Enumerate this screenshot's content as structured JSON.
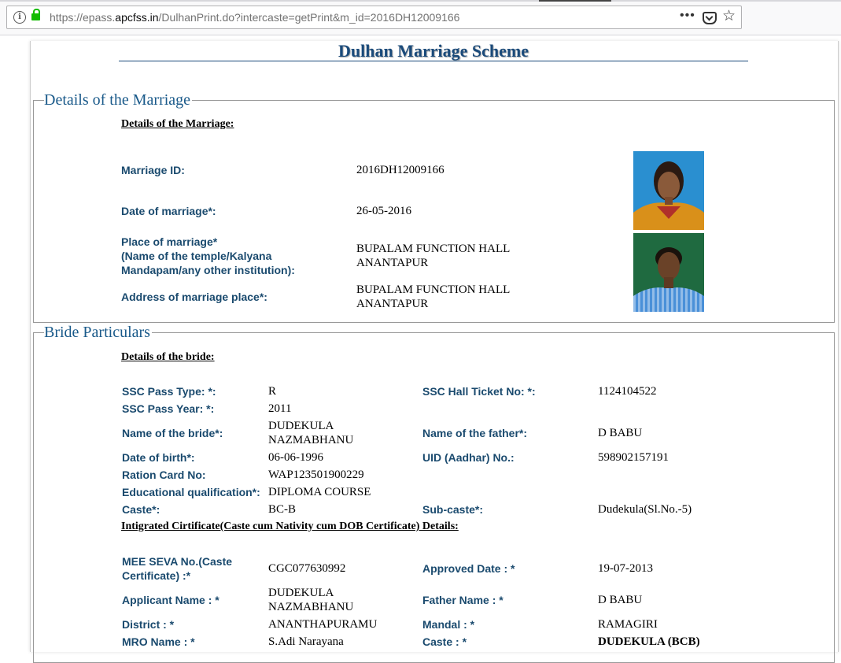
{
  "browser": {
    "url_prefix": "https://epass.",
    "url_domain": "apcfss.in",
    "url_suffix": "/DulhanPrint.do?intercaste=getPrint&m_id=2016DH12009166",
    "menu_glyph": "•••",
    "bookmark_glyph": "☆",
    "info_glyph": "i"
  },
  "page_title": "Dulhan Marriage Scheme",
  "marriage": {
    "legend": "Details of the Marriage",
    "heading": "Details of the Marriage:",
    "id_label": "Marriage ID:",
    "id_value": "2016DH12009166",
    "date_label": "Date of marriage*:",
    "date_value": "26-05-2016",
    "place_label_1": "Place of marriage*",
    "place_label_2": "(Name of the temple/Kalyana",
    "place_label_3": "Mandapam/any other institution):",
    "place_value_1": "BUPALAM FUNCTION HALL",
    "place_value_2": "ANANTAPUR",
    "address_label": "Address of marriage place*:",
    "address_value_1": "BUPALAM FUNCTION HALL",
    "address_value_2": "ANANTAPUR"
  },
  "bride": {
    "legend": "Bride Particulars",
    "heading": "Details of the bride:",
    "ssc_type_label": "SSC Pass Type: *:",
    "ssc_type_value": "R",
    "ssc_hall_label": "SSC Hall Ticket No: *:",
    "ssc_hall_value": "1124104522",
    "ssc_year_label": "SSC Pass Year: *:",
    "ssc_year_value": "2011",
    "name_label": "Name of the bride*:",
    "name_value_1": "DUDEKULA",
    "name_value_2": "NAZMABHANU",
    "father_label": "Name of the father*:",
    "father_value": "D BABU",
    "dob_label": "Date of birth*:",
    "dob_value": "06-06-1996",
    "uid_label": "UID (Aadhar) No.:",
    "uid_value": "598902157191",
    "ration_label": "Ration Card No:",
    "ration_value": "WAP123501900229",
    "edu_label": "Educational qualification*:",
    "edu_value": "DIPLOMA COURSE",
    "caste_label": "Caste*:",
    "caste_value": "BC-B",
    "subcaste_label": "Sub-caste*:",
    "subcaste_value": "Dudekula(Sl.No.-5)",
    "cert_heading": "Intigrated Cirtificate(Caste cum Nativity cum DOB Certificate) Details:",
    "meeseva_label_1": "MEE SEVA No.(Caste",
    "meeseva_label_2": "Certificate) :*",
    "meeseva_value": "CGC077630992",
    "approved_label": "Approved Date : *",
    "approved_value": "19-07-2013",
    "applicant_label": "Applicant Name : *",
    "applicant_value_1": "DUDEKULA",
    "applicant_value_2": "NAZMABHANU",
    "cert_father_label": "Father Name : *",
    "cert_father_value": "D BABU",
    "district_label": "District : *",
    "district_value": "ANANTHAPURAMU",
    "mandal_label": "Mandal : *",
    "mandal_value": "RAMAGIRI",
    "mro_label": "MRO Name : *",
    "mro_value": "S.Adi Narayana",
    "cert_caste_label": "Caste : *",
    "cert_caste_value": "DUDEKULA (BCB)"
  },
  "colors": {
    "label": "#1a4a6e",
    "legend": "#1a5a8a",
    "lock": "#12bc00"
  }
}
